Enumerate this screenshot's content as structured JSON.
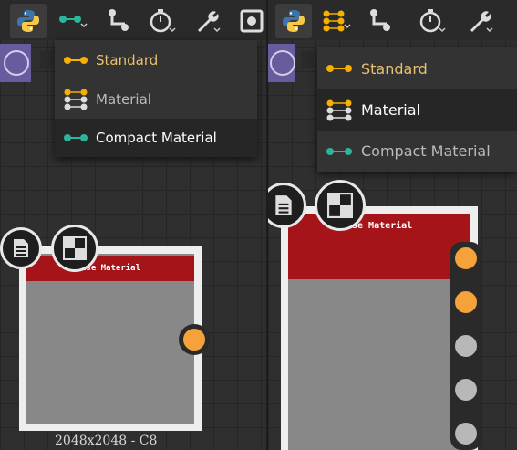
{
  "toolbar": {
    "icons": [
      "python-icon",
      "compact-graph-icon",
      "connector-icon",
      "timer-icon",
      "wrench-icon",
      "screenshot-icon"
    ]
  },
  "menu": {
    "items": [
      {
        "label": "Standard",
        "icon": "standard-icon"
      },
      {
        "label": "Material",
        "icon": "material-icon"
      },
      {
        "label": "Compact Material",
        "icon": "compact-material-icon"
      }
    ],
    "left_selected": "Compact Material",
    "right_selected": "Material"
  },
  "node": {
    "left_title": "ase Material",
    "right_title": "se Material",
    "resolution": "2048x2048 - C8"
  },
  "colors": {
    "node_header": "#a51418",
    "port_active": "#f5a23a",
    "port_inactive": "#b8b8b8",
    "compact_icon": "#2bb59a",
    "standard_icon": "#f5b000"
  }
}
